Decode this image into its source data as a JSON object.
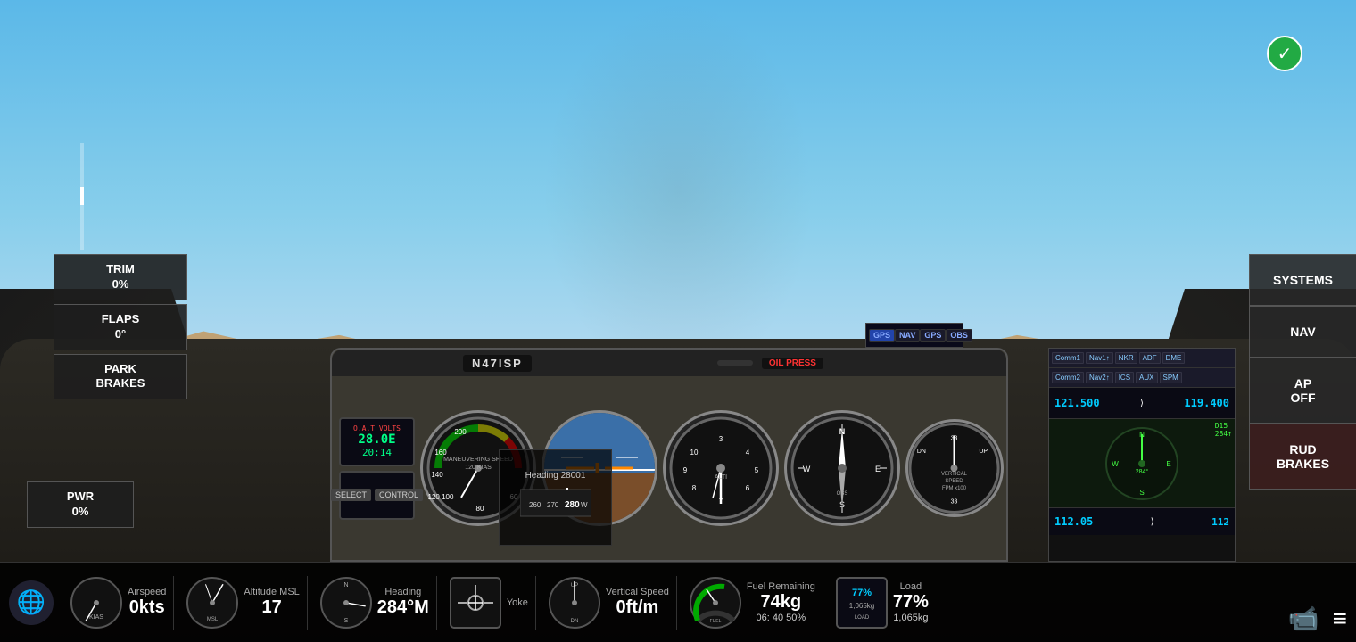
{
  "scene": {
    "aircraft_id": "N47ISP",
    "oil_press": "OIL PRESS"
  },
  "controls": {
    "trim_label": "TRIM",
    "trim_value": "0%",
    "flaps_label": "FLAPS",
    "flaps_value": "0°",
    "park_brakes_label": "PARK\nBRAKES",
    "pwr_label": "PWR",
    "pwr_value": "0%"
  },
  "right_buttons": {
    "systems": "SYSTEMS",
    "nav": "NAV",
    "ap_off": "AP\nOFF",
    "rud_brakes": "RUD\nBRAKES"
  },
  "status": {
    "airspeed_label": "Airspeed",
    "airspeed_value": "0kts",
    "altitude_label": "Altitude MSL",
    "altitude_value": "17",
    "heading_label": "Heading",
    "heading_value": "284°M",
    "heading_display": "Heading 28001",
    "yoke_label": "Yoke",
    "vertical_speed_label": "Vertical Speed",
    "vertical_speed_value": "0ft/m",
    "fuel_label": "Fuel Remaining",
    "fuel_value": "74kg",
    "fuel_sub": "06: 40  50%",
    "load_label": "Load",
    "load_value": "77%",
    "load_sub": "1,065kg"
  },
  "avionics": {
    "freq1": "121.500",
    "freq2": "119.400",
    "freq3": "112.05",
    "freq4": "112"
  },
  "gps": {
    "gps_btn": "GPS",
    "nav_btn": "NAV",
    "gps2_btn": "GPS",
    "obs_btn": "OBS"
  },
  "icons": {
    "check": "✓",
    "globe": "🌐",
    "video": "📹",
    "menu": "≡"
  }
}
